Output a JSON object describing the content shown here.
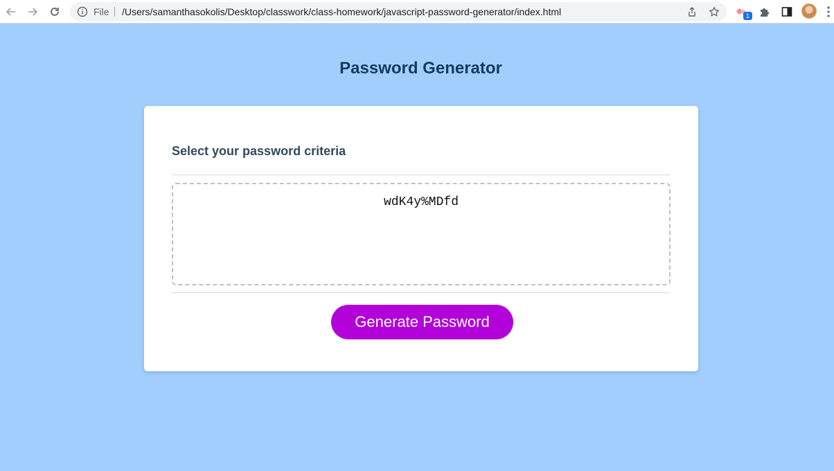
{
  "browser": {
    "scheme_label": "File",
    "url": "/Users/samanthasokolis/Desktop/classwork/class-homework/javascript-password-generator/index.html",
    "extension_badge": "1",
    "icons": [
      "back-arrow-icon",
      "forward-arrow-icon",
      "reload-icon",
      "info-icon",
      "share-icon",
      "star-icon",
      "extension-icon",
      "puzzle-icon",
      "side-panel-icon",
      "avatar",
      "more-menu-icon"
    ]
  },
  "page": {
    "title": "Password Generator",
    "card": {
      "header": "Select your password criteria",
      "password": "wdK4y%MDfd",
      "generate_label": "Generate Password"
    }
  },
  "colors": {
    "background": "#a1cefd",
    "title": "#143b5c",
    "button": "#b202d9"
  }
}
